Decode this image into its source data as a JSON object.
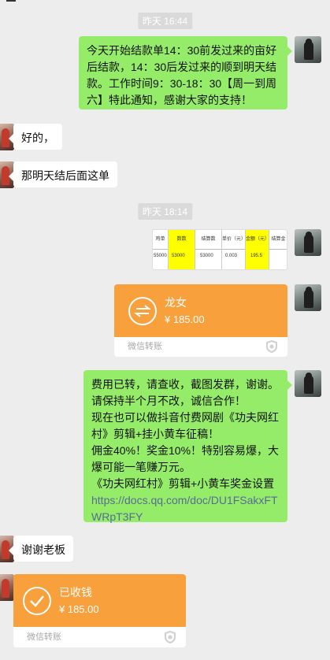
{
  "time1": "昨天 16:44",
  "time2": "昨天 18:14",
  "messages": {
    "m1": "今天开始结款单14：30前发过来的亩好后结款，14：30后发过来的顺到明天结款。工作时间9：30-18：30【周一到周六】特此通知，感谢大家的支持！",
    "m2": "好的，",
    "m3": "那明天结后面这单",
    "m5_text": "费用已转，请查收，截图发群，谢谢。请保持半个月不改，诚信合作！\n现在也可以做抖音付费网剧《功夫网红村》剪辑+挂小黄车征稿！\n佣金40%！奖金10%！特别容易爆，大爆可能一笔赚万元。\n《功夫网红村》剪辑+小黄车奖金设置",
    "m5_link": "https://docs.qq.com/doc/DU1FSakxFTWRpT3FY",
    "m6": "谢谢老板"
  },
  "image_table": {
    "headers": [
      "鸡单",
      "数数",
      "结算数",
      "单价（元）",
      "金额（元）",
      "结算金"
    ],
    "values": [
      "55000",
      "53000",
      "53000",
      "0.003",
      "195.5",
      ""
    ],
    "highlight_color": "#ffff00"
  },
  "transfer1": {
    "name": "龙女",
    "amount": "¥ 185.00",
    "footer": "微信转账"
  },
  "transfer2": {
    "name": "已收钱",
    "amount": "¥ 185.00",
    "footer": "微信转账"
  },
  "colors": {
    "background": "#ededed",
    "green_bubble": "#95ec69",
    "transfer_orange": "#f8a03c"
  }
}
